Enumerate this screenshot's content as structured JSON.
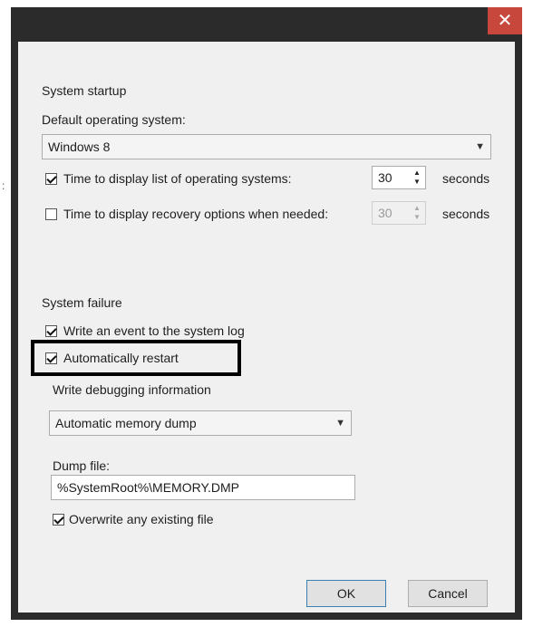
{
  "window": {
    "close_glyph": "✕"
  },
  "startup": {
    "section_label": "System startup",
    "default_os_label": "Default operating system:",
    "default_os_value": "Windows 8",
    "display_list": {
      "checked": true,
      "label": "Time to display list of operating systems:",
      "value": "30",
      "unit": "seconds"
    },
    "display_recovery": {
      "checked": false,
      "label": "Time to display recovery options when needed:",
      "value": "30",
      "unit": "seconds"
    }
  },
  "failure": {
    "section_label": "System failure",
    "write_event": {
      "checked": true,
      "label": "Write an event to the system log"
    },
    "auto_restart": {
      "checked": true,
      "label": "Automatically restart"
    },
    "debug_label": "Write debugging information",
    "debug_value": "Automatic memory dump",
    "dump_file_label": "Dump file:",
    "dump_file_value": "%SystemRoot%\\MEMORY.DMP",
    "overwrite": {
      "checked": true,
      "label": "Overwrite any existing file"
    }
  },
  "buttons": {
    "ok": "OK",
    "cancel": "Cancel"
  },
  "icons": {
    "dropdown": "chevron-down-icon",
    "spinner": "spin-updown-icon",
    "close": "close-icon"
  },
  "colors": {
    "title_bar": "#2b2b2b",
    "close_button": "#c7473c",
    "dialog_bg": "#f0f0f0",
    "highlight_box": "#000000"
  }
}
